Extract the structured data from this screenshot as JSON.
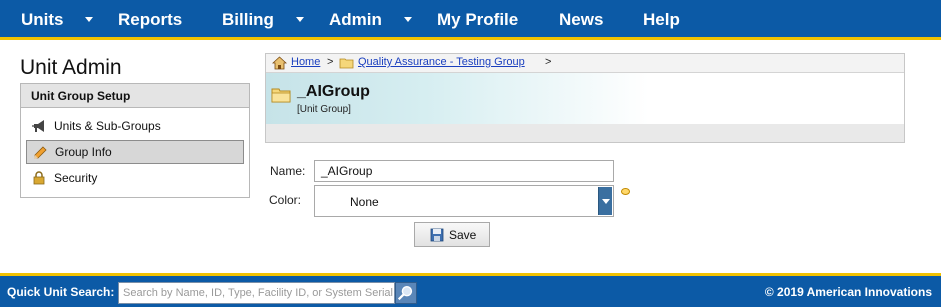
{
  "nav": {
    "units": "Units",
    "reports": "Reports",
    "billing": "Billing",
    "admin": "Admin",
    "my_profile": "My Profile",
    "news": "News",
    "help": "Help"
  },
  "sidebar": {
    "page_title": "Unit Admin",
    "section_title": "Unit Group Setup",
    "items": [
      {
        "label": "Units & Sub-Groups",
        "icon": "megaphone-icon"
      },
      {
        "label": "Group Info",
        "icon": "pencil-icon",
        "active": true
      },
      {
        "label": "Security",
        "icon": "lock-icon"
      }
    ]
  },
  "breadcrumb": {
    "home": "Home",
    "sep1": ">",
    "group": "Quality Assurance - Testing Group",
    "sep2": ">"
  },
  "header": {
    "title": "_AIGroup",
    "subtitle": "[Unit Group]"
  },
  "form": {
    "name_label": "Name:",
    "name_value": "_AIGroup",
    "color_label": "Color:",
    "color_value": "None",
    "save_label": "Save"
  },
  "footer": {
    "quick_search_label": "Quick Unit Search:",
    "search_placeholder": "Search by Name, ID, Type, Facility ID, or System Serial",
    "copyright": "© 2019 American Innovations"
  },
  "colors": {
    "nav_bg": "#0c5aa6",
    "accent_yellow": "#f2c200",
    "link": "#1a3fbf"
  }
}
